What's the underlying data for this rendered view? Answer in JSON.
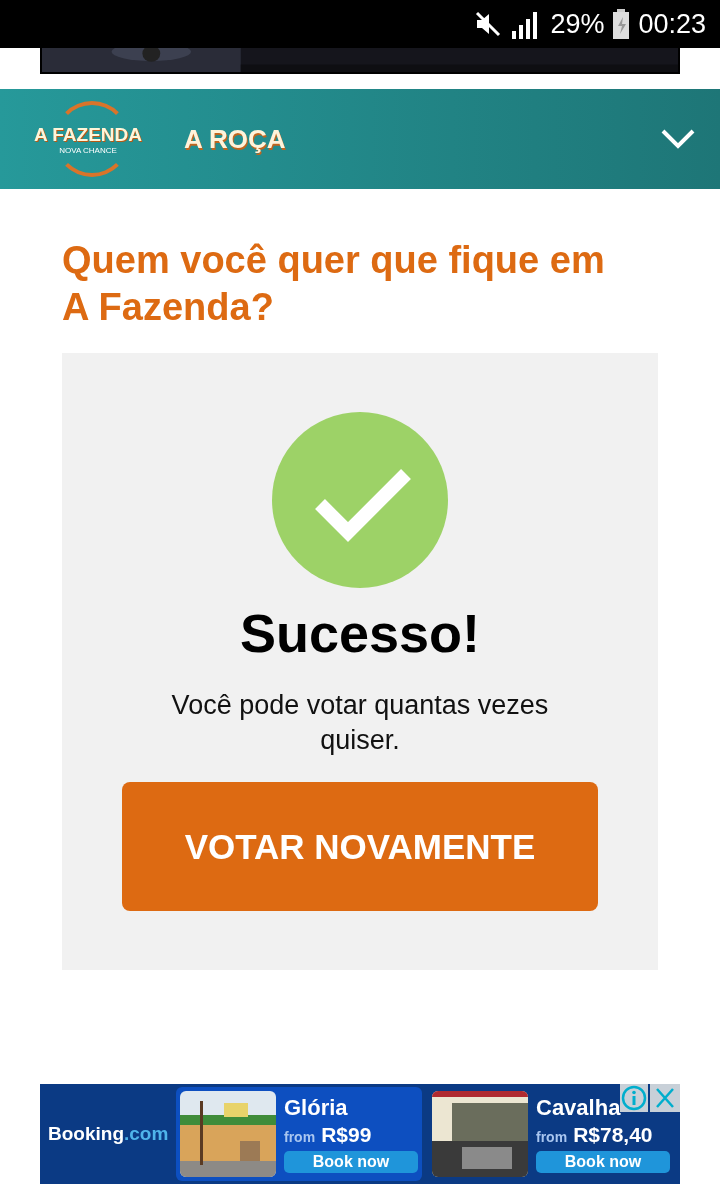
{
  "status_bar": {
    "battery": "29%",
    "time": "00:23"
  },
  "header": {
    "logo_title": "A FAZENDA",
    "logo_subtitle": "NOVA CHANCE",
    "section": "A ROÇA"
  },
  "poll": {
    "question": "Quem você quer que fique em A Fazenda?",
    "result_title": "Sucesso!",
    "message": "Você pode votar quantas vezes quiser.",
    "button": "VOTAR NOVAMENTE"
  },
  "ad": {
    "brand_name": "Booking",
    "brand_suffix": ".com",
    "offers": [
      {
        "city": "Glória",
        "from": "from",
        "price": "R$99",
        "button": "Book now",
        "selected": true
      },
      {
        "city": "Cavalha",
        "from": "from",
        "price": "R$78,40",
        "button": "Book now",
        "selected": false
      }
    ]
  }
}
